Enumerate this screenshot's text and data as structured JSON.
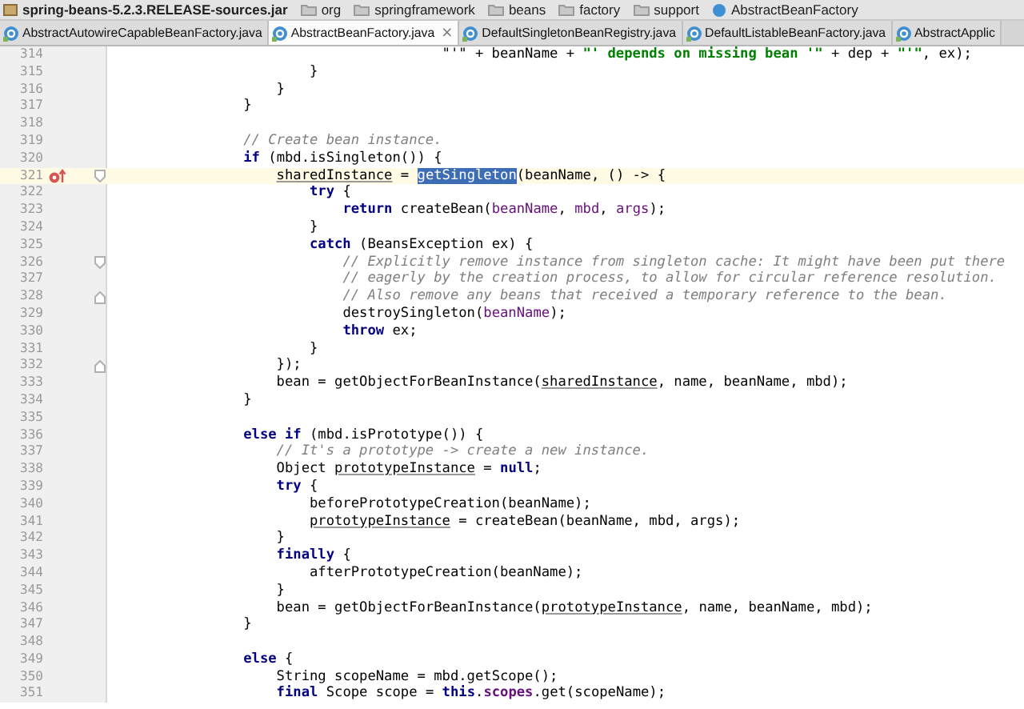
{
  "breadcrumbs": [
    {
      "label": "spring-beans-5.2.3.RELEASE-sources.jar",
      "kind": "jar"
    },
    {
      "label": "org",
      "kind": "folder"
    },
    {
      "label": "springframework",
      "kind": "folder"
    },
    {
      "label": "beans",
      "kind": "folder"
    },
    {
      "label": "factory",
      "kind": "folder"
    },
    {
      "label": "support",
      "kind": "folder"
    },
    {
      "label": "AbstractBeanFactory",
      "kind": "class"
    }
  ],
  "tabs": [
    {
      "label": "AbstractAutowireCapableBeanFactory.java",
      "selected": false
    },
    {
      "label": "AbstractBeanFactory.java",
      "selected": true,
      "close": "×"
    },
    {
      "label": "DefaultSingletonBeanRegistry.java",
      "selected": false
    },
    {
      "label": "DefaultListableBeanFactory.java",
      "selected": false
    },
    {
      "label": "AbstractApplic",
      "selected": false
    }
  ],
  "lines": [
    {
      "number": "314",
      "current": false,
      "tokens": [
        {
          "kind": "plain",
          "text": "                                    \"'\" + beanName + "
        },
        {
          "kind": "string",
          "text": "\"' depends on missing bean '\""
        },
        {
          "kind": "plain",
          "text": " + dep + "
        },
        {
          "kind": "string",
          "text": "\"'\""
        },
        {
          "kind": "plain",
          "text": ", ex);"
        }
      ]
    },
    {
      "number": "315",
      "current": false,
      "tokens": [
        {
          "kind": "plain",
          "text": "                    }"
        }
      ]
    },
    {
      "number": "316",
      "current": false,
      "tokens": [
        {
          "kind": "plain",
          "text": "                }"
        }
      ]
    },
    {
      "number": "317",
      "current": false,
      "tokens": [
        {
          "kind": "plain",
          "text": "            }"
        }
      ]
    },
    {
      "number": "318",
      "current": false
    },
    {
      "number": "319",
      "current": false,
      "tokens": [
        {
          "kind": "comment",
          "text": "            // Create bean instance."
        }
      ]
    },
    {
      "number": "320",
      "current": false,
      "tokens": [
        {
          "kind": "keyword",
          "text": "            if"
        },
        {
          "kind": "plain",
          "text": " (mbd.isSingleton()) {"
        }
      ]
    },
    {
      "number": "321",
      "current": true,
      "gutter_icon": {
        "kind": "recursion"
      },
      "fold_marker": {
        "kind": "open"
      },
      "tokens": [
        {
          "kind": "underlined",
          "text": "                sharedInstance"
        },
        {
          "kind": "plain",
          "text": " = "
        },
        {
          "kind": "selected",
          "text": "getSingleton"
        },
        {
          "kind": "plain",
          "text": "(beanName, () -> {"
        }
      ]
    },
    {
      "number": "322",
      "current": false,
      "tokens": [
        {
          "kind": "keyword",
          "text": "                    try"
        },
        {
          "kind": "plain",
          "text": " {"
        }
      ]
    },
    {
      "number": "323",
      "current": false,
      "tokens": [
        {
          "kind": "keyword",
          "text": "                        return"
        },
        {
          "kind": "plain",
          "text": " createBean("
        },
        {
          "kind": "param",
          "text": "beanName"
        },
        {
          "kind": "plain",
          "text": ", "
        },
        {
          "kind": "param",
          "text": "mbd"
        },
        {
          "kind": "plain",
          "text": ", "
        },
        {
          "kind": "param",
          "text": "args"
        },
        {
          "kind": "plain",
          "text": ");"
        }
      ]
    },
    {
      "number": "324",
      "current": false,
      "tokens": [
        {
          "kind": "plain",
          "text": "                    }"
        }
      ]
    },
    {
      "number": "325",
      "current": false,
      "tokens": [
        {
          "kind": "keyword",
          "text": "                    catch"
        },
        {
          "kind": "plain",
          "text": " (BeansException ex) {"
        }
      ]
    },
    {
      "number": "326",
      "current": false,
      "fold_marker": {
        "kind": "open"
      },
      "tokens": [
        {
          "kind": "comment",
          "text": "                        // Explicitly remove instance from singleton cache: It might have been put there"
        }
      ]
    },
    {
      "number": "327",
      "current": false,
      "tokens": [
        {
          "kind": "comment",
          "text": "                        // eagerly by the creation process, to allow for circular reference resolution."
        }
      ]
    },
    {
      "number": "328",
      "current": false,
      "fold_marker": {
        "kind": "close"
      },
      "tokens": [
        {
          "kind": "comment",
          "text": "                        // Also remove any beans that received a temporary reference to the bean."
        }
      ]
    },
    {
      "number": "329",
      "current": false,
      "tokens": [
        {
          "kind": "plain",
          "text": "                        destroySingleton("
        },
        {
          "kind": "param",
          "text": "beanName"
        },
        {
          "kind": "plain",
          "text": ");"
        }
      ]
    },
    {
      "number": "330",
      "current": false,
      "tokens": [
        {
          "kind": "keyword",
          "text": "                        throw"
        },
        {
          "kind": "plain",
          "text": " ex;"
        }
      ]
    },
    {
      "number": "331",
      "current": false,
      "tokens": [
        {
          "kind": "plain",
          "text": "                    }"
        }
      ]
    },
    {
      "number": "332",
      "current": false,
      "fold_marker": {
        "kind": "close"
      },
      "tokens": [
        {
          "kind": "plain",
          "text": "                });"
        }
      ]
    },
    {
      "number": "333",
      "current": false,
      "tokens": [
        {
          "kind": "plain",
          "text": "                bean = getObjectForBeanInstance("
        },
        {
          "kind": "underlined",
          "text": "sharedInstance"
        },
        {
          "kind": "plain",
          "text": ", name, beanName, mbd);"
        }
      ]
    },
    {
      "number": "334",
      "current": false,
      "tokens": [
        {
          "kind": "plain",
          "text": "            }"
        }
      ]
    },
    {
      "number": "335",
      "current": false
    },
    {
      "number": "336",
      "current": false,
      "tokens": [
        {
          "kind": "keyword",
          "text": "            else if"
        },
        {
          "kind": "plain",
          "text": " (mbd.isPrototype()) {"
        }
      ]
    },
    {
      "number": "337",
      "current": false,
      "tokens": [
        {
          "kind": "comment",
          "text": "                // It's a prototype -> create a new instance."
        }
      ]
    },
    {
      "number": "338",
      "current": false,
      "tokens": [
        {
          "kind": "plain",
          "text": "                Object "
        },
        {
          "kind": "underlined",
          "text": "prototypeInstance"
        },
        {
          "kind": "plain",
          "text": " = "
        },
        {
          "kind": "keyword",
          "text": "null"
        },
        {
          "kind": "plain",
          "text": ";"
        }
      ]
    },
    {
      "number": "339",
      "current": false,
      "tokens": [
        {
          "kind": "keyword",
          "text": "                try"
        },
        {
          "kind": "plain",
          "text": " {"
        }
      ]
    },
    {
      "number": "340",
      "current": false,
      "tokens": [
        {
          "kind": "plain",
          "text": "                    beforePrototypeCreation(beanName);"
        }
      ]
    },
    {
      "number": "341",
      "current": false,
      "tokens": [
        {
          "kind": "underlined",
          "text": "                    prototypeInstance"
        },
        {
          "kind": "plain",
          "text": " = createBean(beanName, mbd, args);"
        }
      ]
    },
    {
      "number": "342",
      "current": false,
      "tokens": [
        {
          "kind": "plain",
          "text": "                }"
        }
      ]
    },
    {
      "number": "343",
      "current": false,
      "tokens": [
        {
          "kind": "keyword",
          "text": "                finally"
        },
        {
          "kind": "plain",
          "text": " {"
        }
      ]
    },
    {
      "number": "344",
      "current": false,
      "tokens": [
        {
          "kind": "plain",
          "text": "                    afterPrototypeCreation(beanName);"
        }
      ]
    },
    {
      "number": "345",
      "current": false,
      "tokens": [
        {
          "kind": "plain",
          "text": "                }"
        }
      ]
    },
    {
      "number": "346",
      "current": false,
      "tokens": [
        {
          "kind": "plain",
          "text": "                bean = getObjectForBeanInstance("
        },
        {
          "kind": "underlined",
          "text": "prototypeInstance"
        },
        {
          "kind": "plain",
          "text": ", name, beanName, mbd);"
        }
      ]
    },
    {
      "number": "347",
      "current": false,
      "tokens": [
        {
          "kind": "plain",
          "text": "            }"
        }
      ]
    },
    {
      "number": "348",
      "current": false
    },
    {
      "number": "349",
      "current": false,
      "tokens": [
        {
          "kind": "keyword",
          "text": "            else"
        },
        {
          "kind": "plain",
          "text": " {"
        }
      ]
    },
    {
      "number": "350",
      "current": false,
      "tokens": [
        {
          "kind": "plain",
          "text": "                String scopeName = mbd.getScope();"
        }
      ]
    },
    {
      "number": "351",
      "current": false,
      "tokens": [
        {
          "kind": "keyword",
          "text": "                final"
        },
        {
          "kind": "plain",
          "text": " Scope scope = "
        },
        {
          "kind": "keyword",
          "text": "this"
        },
        {
          "kind": "plain",
          "text": "."
        },
        {
          "kind": "field",
          "text": "scopes"
        },
        {
          "kind": "plain",
          "text": ".get(scopeName);"
        }
      ]
    }
  ]
}
